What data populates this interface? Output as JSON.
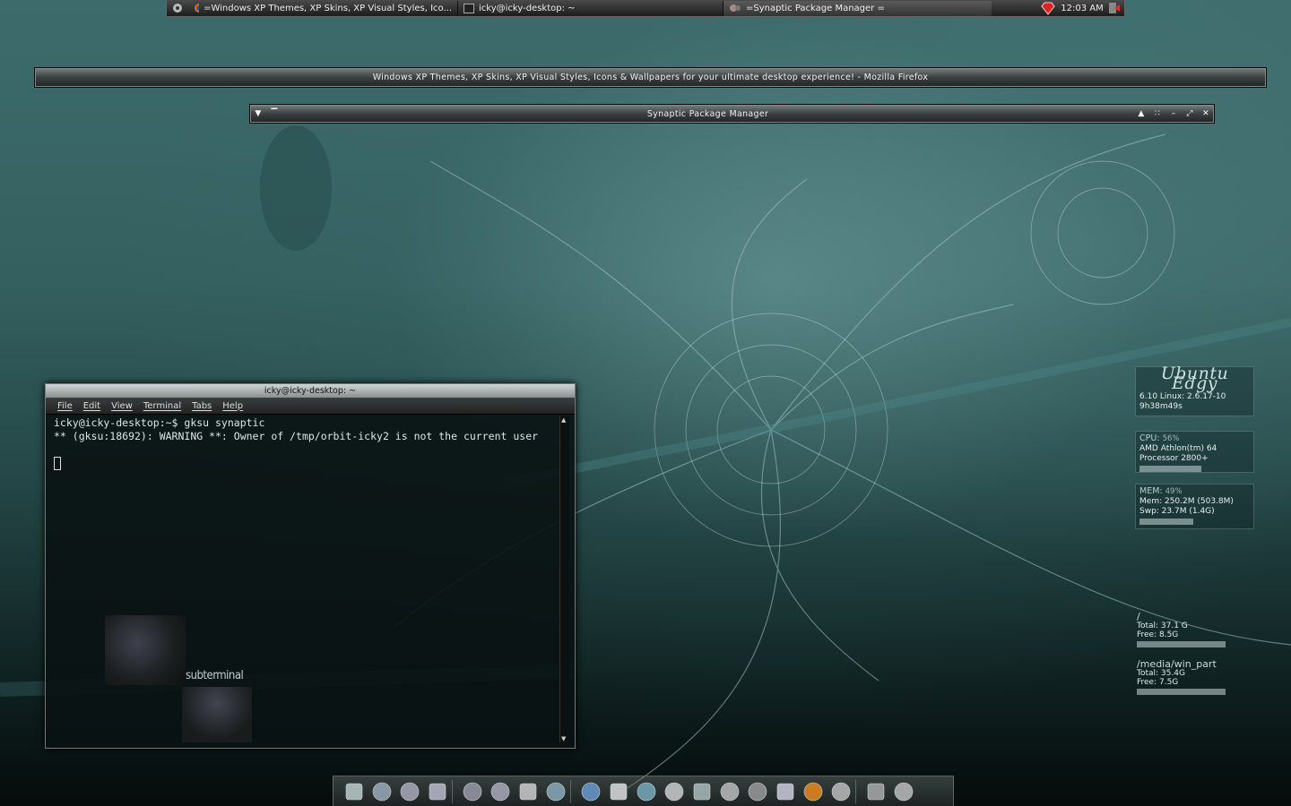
{
  "top_panel": {
    "tasks": [
      {
        "label": "=Windows XP Themes, XP Skins, XP Visual Styles, Ico...",
        "icon": "firefox-icon"
      },
      {
        "label": "icky@icky-desktop: ~",
        "icon": "terminal-icon"
      },
      {
        "label": "=Synaptic Package Manager =",
        "icon": "synaptic-icon"
      }
    ],
    "clock": "12:03 AM"
  },
  "windows": {
    "firefox_title": "Windows XP Themes, XP Skins, XP Visual Styles, Icons & Wallpapers for your ultimate desktop experience! - Mozilla Firefox",
    "synaptic_title": "Synaptic Package Manager"
  },
  "terminal": {
    "title": "icky@icky-desktop: ~",
    "menu": [
      "File",
      "Edit",
      "View",
      "Terminal",
      "Tabs",
      "Help"
    ],
    "lines": [
      "icky@icky-desktop:~$ gksu synaptic",
      "",
      "** (gksu:18692): WARNING **: Owner of /tmp/orbit-icky2 is not the current user"
    ],
    "wallpaper_text": "subterminal"
  },
  "conky": {
    "logo": "Ubuntu Edgy",
    "os": "6.10 Linux: 2.6.17-10",
    "uptime": "9h38m49s",
    "cpu_label": "CPU:",
    "cpu_pct": "56%",
    "cpu_usage": 0.56,
    "cpu_name_1": "AMD Athlon(tm) 64",
    "cpu_name_2": "Processor 2800+",
    "mem_label": "MEM:",
    "mem_pct": "49%",
    "mem_line": "Mem: 250.2M (503.8M)",
    "swp_line": "Swp: 23.7M (1.4G)",
    "mem_usage": 0.49,
    "fs": [
      {
        "name": "/",
        "total": "Total: 37.1 G",
        "free": "Free: 8.5G",
        "usage": 0.77
      },
      {
        "name": "/media/win_part",
        "total": "Total: 35.4G",
        "free": "Free: 7.5G",
        "usage": 0.79
      }
    ]
  },
  "dock": {
    "icons": [
      "trash-icon",
      "display-icon",
      "network-icon",
      "network-icon-2",
      "monitor-icon",
      "monitor-icon-2",
      "calendar-icon",
      "gear-icon",
      "firefox-icon",
      "opera-icon",
      "globe-icon",
      "sword-icon",
      "users-icon",
      "cz-icon",
      "gimp-icon",
      "mail-icon",
      "vlc-icon",
      "pen-icon",
      "speaker-icon",
      "bin-icon"
    ]
  }
}
